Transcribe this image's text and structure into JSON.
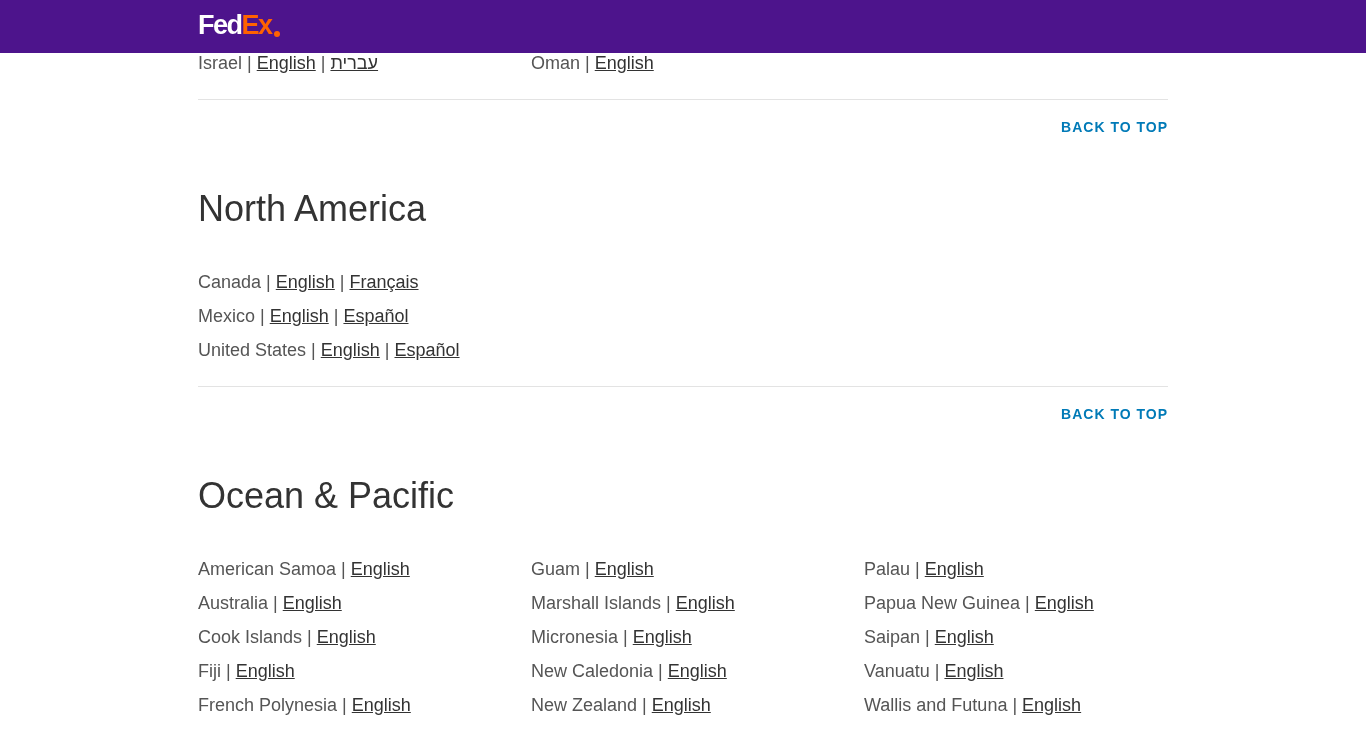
{
  "header": {
    "logo": {
      "parts": [
        "Fed",
        "Ex"
      ]
    }
  },
  "sections": [
    {
      "columns": [
        [
          {
            "name": "Israel",
            "languages": [
              {
                "separator": "|",
                "label": "English"
              },
              {
                "separator": "|",
                "label": "עברית"
              }
            ]
          }
        ],
        [
          {
            "name": "Oman",
            "languages": [
              {
                "separator": "|",
                "label": "English"
              }
            ]
          }
        ]
      ],
      "back_to_top": "BACK TO TOP"
    },
    {
      "title": "North America",
      "columns": [
        [
          {
            "name": "Canada",
            "languages": [
              {
                "separator": "|",
                "label": "English"
              },
              {
                "separator": "|",
                "label": "Français"
              }
            ]
          },
          {
            "name": "Mexico",
            "languages": [
              {
                "separator": "|",
                "label": "English"
              },
              {
                "separator": "|",
                "label": "Español"
              }
            ]
          },
          {
            "name": "United States",
            "languages": [
              {
                "separator": "|",
                "label": "English"
              },
              {
                "separator": "|",
                "label": "Español"
              }
            ]
          }
        ]
      ],
      "back_to_top": "BACK TO TOP"
    },
    {
      "title": "Ocean & Pacific",
      "columns": [
        [
          {
            "name": "American Samoa",
            "languages": [
              {
                "separator": "|",
                "label": "English"
              }
            ]
          },
          {
            "name": "Australia",
            "languages": [
              {
                "separator": "|",
                "label": "English"
              }
            ]
          },
          {
            "name": "Cook Islands",
            "languages": [
              {
                "separator": "|",
                "label": "English"
              }
            ]
          },
          {
            "name": "Fiji",
            "languages": [
              {
                "separator": "|",
                "label": "English"
              }
            ]
          },
          {
            "name": "French Polynesia",
            "languages": [
              {
                "separator": "|",
                "label": "English"
              }
            ]
          }
        ],
        [
          {
            "name": "Guam",
            "languages": [
              {
                "separator": "|",
                "label": "English"
              }
            ]
          },
          {
            "name": "Marshall Islands",
            "languages": [
              {
                "separator": "|",
                "label": "English"
              }
            ]
          },
          {
            "name": "Micronesia",
            "languages": [
              {
                "separator": "|",
                "label": "English"
              }
            ]
          },
          {
            "name": "New Caledonia",
            "languages": [
              {
                "separator": "|",
                "label": "English"
              }
            ]
          },
          {
            "name": "New Zealand",
            "languages": [
              {
                "separator": "|",
                "label": "English"
              }
            ]
          }
        ],
        [
          {
            "name": "Palau",
            "languages": [
              {
                "separator": "|",
                "label": "English"
              }
            ]
          },
          {
            "name": "Papua New Guinea",
            "languages": [
              {
                "separator": "|",
                "label": "English"
              }
            ]
          },
          {
            "name": "Saipan",
            "languages": [
              {
                "separator": "|",
                "label": "English"
              }
            ]
          },
          {
            "name": "Vanuatu",
            "languages": [
              {
                "separator": "|",
                "label": "English"
              }
            ]
          },
          {
            "name": "Wallis and Futuna",
            "languages": [
              {
                "separator": "|",
                "label": "English"
              }
            ]
          }
        ]
      ]
    }
  ]
}
